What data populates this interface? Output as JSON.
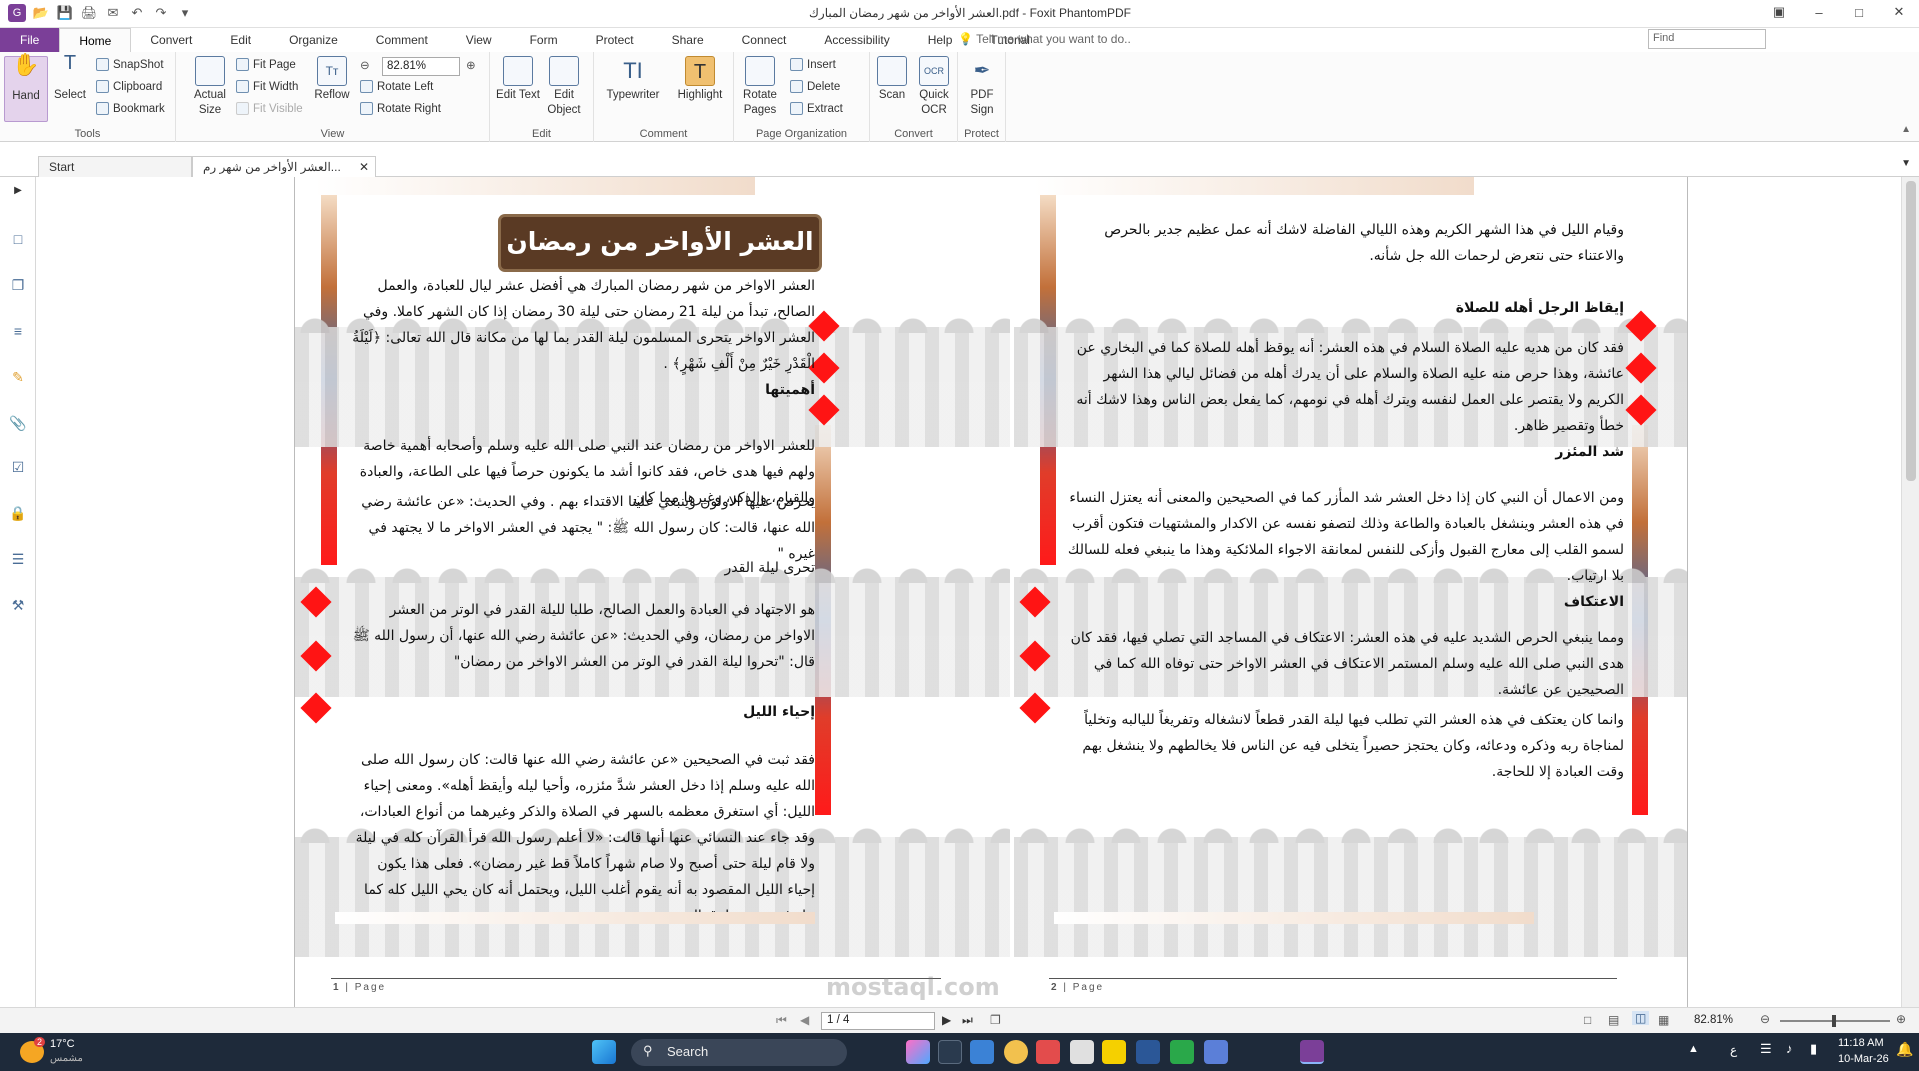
{
  "window": {
    "title": "العشر الأواخر من شهر رمضان المبارك.pdf - Foxit PhantomPDF"
  },
  "menu": {
    "tabs": [
      "File",
      "Home",
      "Convert",
      "Edit",
      "Organize",
      "Comment",
      "View",
      "Form",
      "Protect",
      "Share",
      "Connect",
      "Accessibility",
      "Help",
      "Tutorial"
    ],
    "active": "Home",
    "tell_me": "Tell me what you want to do..",
    "find_placeholder": "Find"
  },
  "ribbon": {
    "tools": {
      "hand": "Hand",
      "select": "Select",
      "snapshot": "SnapShot",
      "clipboard": "Clipboard",
      "bookmark": "Bookmark",
      "label": "Tools"
    },
    "view": {
      "actual_size": "Actual Size",
      "fit_page": "Fit Page",
      "fit_width": "Fit Width",
      "fit_visible": "Fit Visible",
      "reflow": "Reflow",
      "zoom": "82.81%",
      "rotate_left": "Rotate Left",
      "rotate_right": "Rotate Right",
      "label": "View"
    },
    "edit": {
      "edit_text": "Edit Text",
      "edit_object": "Edit Object",
      "label": "Edit"
    },
    "comment": {
      "typewriter": "Typewriter",
      "highlight": "Highlight",
      "label": "Comment"
    },
    "page_org": {
      "rotate_pages": "Rotate Pages",
      "insert": "Insert",
      "delete": "Delete",
      "extract": "Extract",
      "label": "Page Organization"
    },
    "convert": {
      "scan": "Scan",
      "quick_ocr": "Quick OCR",
      "label": "Convert"
    },
    "protect": {
      "pdf_sign": "PDF Sign",
      "label": "Protect"
    }
  },
  "doc_tabs": [
    {
      "label": "Start"
    },
    {
      "label": "العشر الأواخر من شهر رم..."
    }
  ],
  "page_left": {
    "banner": "العشر الأواخر من رمضان",
    "p1": "العشر الاواخر من شهر رمضان المبارك هي أفضل عشر ليال للعبادة، والعمل الصالح، تبدأ من ليلة 21 رمضان حتى ليلة 30 رمضان إذا كان الشهر كاملا. وفي العشر الاواخر يتحرى المسلمون ليلة القدر بما لها من مكانة قال الله تعالى: ﴿لَيْلَةُ الْقَدْرِ خَيْرٌ مِنْ أَلْفِ شَهْرٍ﴾ .",
    "h1": "أهميتها",
    "p2": "للعشر الاواخر من رمضان عند النبي صلى الله عليه وسلم وأصحابه أهمية خاصة ولهم فيها هدى خاص، فقد كانوا أشد ما يكونون حرصاً فيها على الطاعة، والعبادة والقيام، والذكر، وغيرها مما كان",
    "p3": "يحرص عليها الاولون وينبغي علينا الاقتداء بهم . وفي الحديث: «عن عائشة رضي الله عنها، قالت: كان رسول الله ﷺ: \" يجتهد في العشر الاواخر ما لا يجتهد في غيره \"",
    "h2": "تحرى ليلة القدر",
    "p4": "هو الاجتهاد في العبادة والعمل الصالح، طلبا لليلة القدر في الوتر من العشر الاواخر من رمضان، وفي الحديث: «عن عائشة رضي الله عنها، أن رسول الله ﷺ قال: \"تحروا ليلة القدر في الوتر من العشر الاواخر من رمضان\"",
    "h3": "إحياء الليل",
    "p5": "فقد ثبت في الصحيحين «عن عائشة رضي الله عنها قالت: كان رسول الله صلى الله عليه وسلم إذا دخل العشر شدَّ مئزره، وأحيا ليله وأيقظ أهله». ومعنى إحياء الليل: أي استغرق معظمه بالسهر في الصلاة والذكر وغيرهما من أنواع العبادات، وقد جاء عند النسائي عنها أنها قالت: «لا أعلم رسول الله قرأ القرآن كله في ليلة ولا قام ليلة حتى أصبح ولا صام شهراً كاملاً قط غير رمضان». فعلى هذا يكون إحياء الليل المقصود به أنه يقوم أغلب الليل، ويحتمل أنه كان يحي الليل كله كما جاء في بعض طرق الحديث.",
    "page_num": "1",
    "page_word": "Page"
  },
  "page_right": {
    "p1": "وقيام الليل في هذا الشهر الكريم وهذه الليالي الفاضلة لاشك أنه عمل عظيم جدير بالحرص والاعتناء حتى نتعرض لرحمات الله جل شأنه.",
    "h1": "إيقاظ الرجل أهله للصلاة",
    "p2": "فقد كان من هديه عليه الصلاة السلام في هذه العشر: أنه يوقظ أهله للصلاة كما في البخاري عن عائشة، وهذا حرص منه عليه الصلاة والسلام على أن يدرك أهله من فضائل ليالي هذا الشهر الكريم ولا يقتصر على العمل لنفسه ويترك أهله في نومهم، كما يفعل بعض الناس وهذا لاشك أنه خطأ وتقصير ظاهر.",
    "h2": "شد المئزر",
    "p3": "ومن الاعمال أن النبي كان إذا دخل العشر شد المأزر كما في الصحيحين والمعنى أنه يعتزل النساء في هذه العشر وينشغل بالعبادة والطاعة وذلك لتصفو نفسه عن الاكدار والمشتهيات فتكون أقرب لسمو القلب إلى معارج القبول وأزكى للنفس لمعانقة الاجواء الملائكية وهذا ما ينبغي فعله للسالك بلا ارتياب.",
    "h3": "الاعتكاف",
    "p4": "ومما ينبغي الحرص الشديد عليه في هذه العشر: الاعتكاف في المساجد التي تصلي فيها، فقد كان هدى النبي صلى الله عليه وسلم المستمر الاعتكاف في العشر الاواخر حتى توفاه الله كما في الصحيحين عن عائشة.",
    "p5": "وانما كان يعتكف في هذه العشر التي تطلب فيها ليلة القدر قطعاً لانشغاله وتفريغاً لليالبه وتخلياً لمناجاة ربه وذكره ودعائه، وكان يحتجز حصيراً يتخلى فيه عن الناس فلا يخالطهم ولا ينشغل بهم وقت العبادة إلا للحاجة.",
    "page_num": "2",
    "page_word": "Page"
  },
  "status": {
    "page_field": "1 / 4",
    "zoom": "82.81%"
  },
  "taskbar": {
    "temp": "17°C",
    "weather": "مشمس",
    "badge": "2",
    "search": "Search",
    "lang": "ع",
    "time": "11:18 AM",
    "date": "10-Mar-26"
  },
  "watermark": "mostaql.com"
}
